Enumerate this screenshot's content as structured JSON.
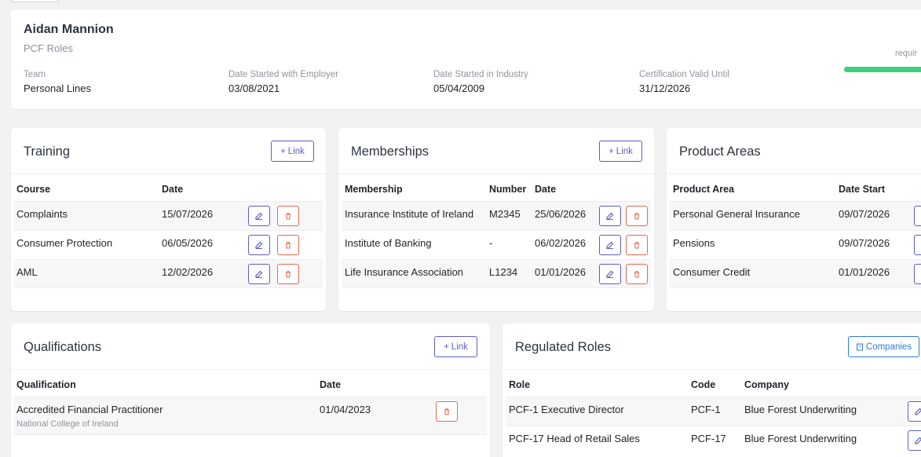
{
  "profile": {
    "name": "Aidan Mannion",
    "subtitle": "PCF Roles",
    "fields": [
      {
        "label": "Team",
        "value": "Personal Lines"
      },
      {
        "label": "Date Started with Employer",
        "value": "03/08/2021"
      },
      {
        "label": "Date Started in Industry",
        "value": "05/04/2009"
      },
      {
        "label": "Certification Valid Until",
        "value": "31/12/2026"
      }
    ],
    "requirements_label": "requir",
    "progress_fraction": 1.0,
    "progress_color": "#3fcf7c"
  },
  "training": {
    "title": "Training",
    "link_label": "Link",
    "headers": [
      "Course",
      "Date"
    ],
    "rows": [
      {
        "course": "Complaints",
        "date": "15/07/2026"
      },
      {
        "course": "Consumer Protection",
        "date": "06/05/2026"
      },
      {
        "course": "AML",
        "date": "12/02/2026"
      }
    ]
  },
  "memberships": {
    "title": "Memberships",
    "link_label": "Link",
    "headers": [
      "Membership",
      "Number",
      "Date"
    ],
    "rows": [
      {
        "membership": "Insurance Institute of Ireland",
        "number": "M2345",
        "date": "25/06/2026"
      },
      {
        "membership": "Institute of Banking",
        "number": "-",
        "date": "06/02/2026"
      },
      {
        "membership": "Life Insurance Association",
        "number": "L1234",
        "date": "01/01/2026"
      }
    ]
  },
  "product_areas": {
    "title": "Product Areas",
    "headers": [
      "Product Area",
      "Date Start"
    ],
    "rows": [
      {
        "area": "Personal General Insurance",
        "date": "09/07/2026"
      },
      {
        "area": "Pensions",
        "date": "09/07/2026"
      },
      {
        "area": "Consumer Credit",
        "date": "01/01/2026"
      }
    ]
  },
  "qualifications": {
    "title": "Qualifications",
    "link_label": "Link",
    "headers": [
      "Qualification",
      "Date"
    ],
    "rows": [
      {
        "qualification": "Accredited Financial Practitioner",
        "institution": "National College of Ireland",
        "date": "01/04/2023"
      }
    ]
  },
  "regulated_roles": {
    "title": "Regulated Roles",
    "companies_label": "Companies",
    "headers": [
      "Role",
      "Code",
      "Company"
    ],
    "rows": [
      {
        "role": "PCF-1 Executive Director",
        "code": "PCF-1",
        "company": "Blue Forest Underwriting"
      },
      {
        "role": "PCF-17 Head of Retail Sales",
        "code": "PCF-17",
        "company": "Blue Forest Underwriting"
      }
    ]
  },
  "colors": {
    "primary": "#5b5fc7",
    "danger": "#e8694f",
    "info": "#2f7be0"
  },
  "icons": {
    "edit": "edit-icon",
    "delete": "trash-icon",
    "add": "plus-icon",
    "companies": "building-icon"
  }
}
